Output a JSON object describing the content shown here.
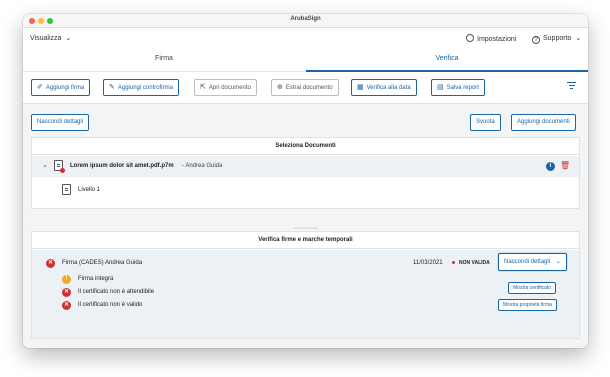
{
  "window": {
    "title": "ArubaSign"
  },
  "menubar": {
    "view_label": "Visualizza",
    "view_caret": "⌄",
    "settings_label": "Impostazioni",
    "support_label": "Supporto",
    "support_caret": "⌄"
  },
  "tabs": [
    {
      "label": "Firma",
      "active": false
    },
    {
      "label": "Verifica",
      "active": true
    }
  ],
  "toolbar": {
    "add_signature": "Aggiungi firma",
    "add_countersignature": "Aggiungi controfirma",
    "open_document": "Apri documento",
    "extract_document": "Estrai documento",
    "verify_at_date": "Verifica alla data",
    "save_report": "Salva report"
  },
  "actions": {
    "hide_details": "Nascondi dettagli",
    "clear": "Svuota",
    "add_documents": "Aggiungi documenti"
  },
  "documents_panel": {
    "title": "Seleziona Documenti",
    "file_name": "Lorem ipsum dolor sit amet.pdf.p7m",
    "file_signer": " - Andrea Guida",
    "level_label": "Livello 1"
  },
  "verify_panel": {
    "title": "Verifica firme e marche temporali",
    "signature_label": "Firma (CADES) Andrea Guida",
    "date": "11/03/2021",
    "status": "NON VALIDA",
    "details_button": "Nascondi dettagli",
    "details_caret": "⌄",
    "checks": [
      {
        "label": "Firma integra",
        "kind": "warn"
      },
      {
        "label": "Il certificato non è attendibile",
        "kind": "err"
      },
      {
        "label": "Il certificato non è valido",
        "kind": "err"
      }
    ],
    "show_certificate": "Mostra certificato",
    "show_signature_properties": "Mostra proprietà firma"
  },
  "colors": {
    "accent": "#1a65a6",
    "error": "#d32f2f",
    "warning": "#f5a623"
  }
}
